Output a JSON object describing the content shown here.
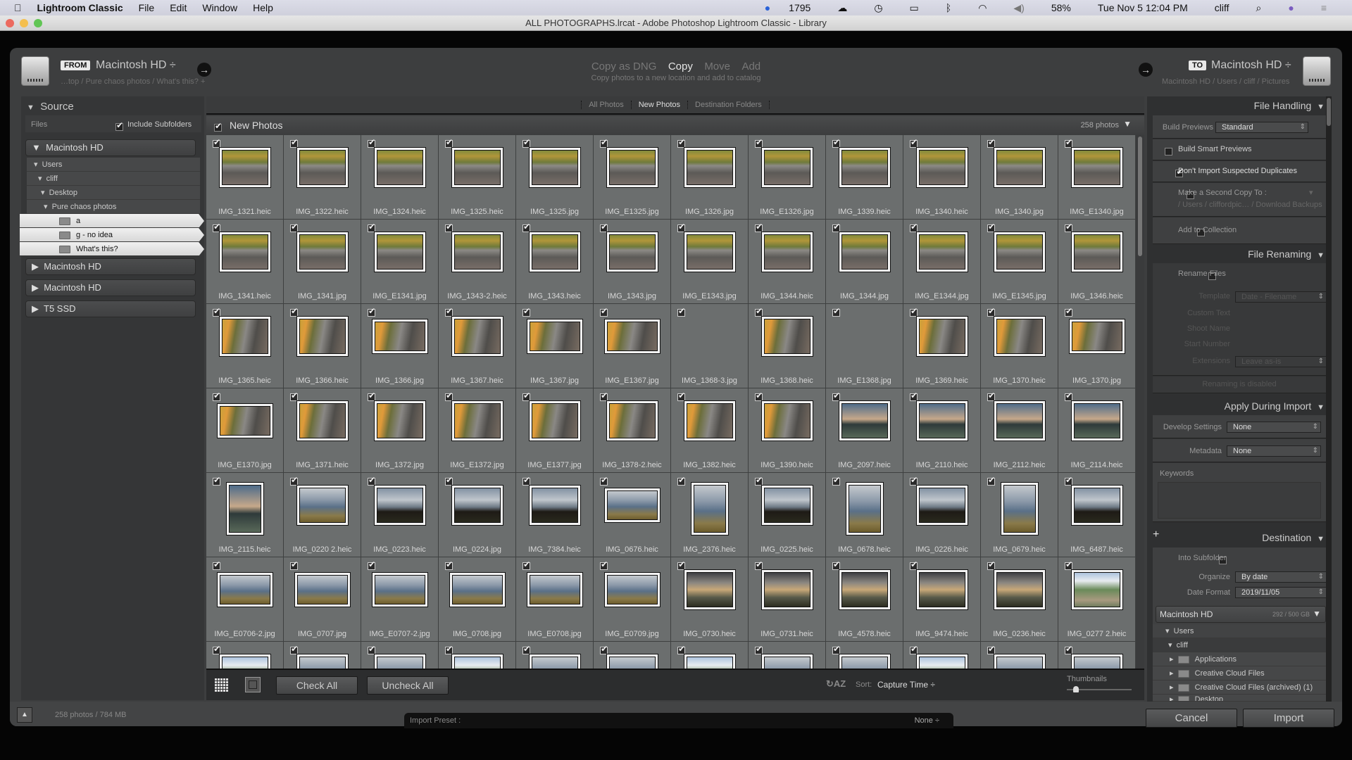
{
  "menubar": {
    "app": "Lightroom Classic",
    "items": [
      "File",
      "Edit",
      "Window",
      "Help"
    ],
    "status": {
      "badge_count": "1795",
      "battery": "58%",
      "datetime": "Tue Nov 5  12:04 PM",
      "user": "cliff"
    }
  },
  "window_title": "ALL PHOTOGRAPHS.lrcat - Adobe Photoshop Lightroom Classic - Library",
  "header": {
    "from_label": "FROM",
    "from_volume": "Macintosh HD ÷",
    "from_path": "…top / Pure chaos photos / What's this? +",
    "modes": [
      "Copy as DNG",
      "Copy",
      "Move",
      "Add"
    ],
    "active_mode": "Copy",
    "mode_description": "Copy photos to a new location and add to catalog",
    "to_label": "TO",
    "to_volume": "Macintosh HD ÷",
    "to_path": "Macintosh HD / Users / cliff / Pictures"
  },
  "source": {
    "title": "Source",
    "files_label": "Files",
    "include_subfolders": "Include Subfolders",
    "include_subfolders_checked": true,
    "tree": [
      {
        "label": "Users"
      },
      {
        "label": "cliff"
      },
      {
        "label": "Desktop"
      },
      {
        "label": "Pure chaos photos"
      }
    ],
    "folders": [
      "a",
      "g - no idea",
      "What's this?"
    ],
    "volumes": [
      "Macintosh HD",
      "Macintosh HD",
      "Macintosh HD",
      "T5 SSD"
    ]
  },
  "tabs": [
    "All Photos",
    "New Photos",
    "Destination Folders"
  ],
  "active_tab": "New Photos",
  "grid": {
    "title": "New Photos",
    "count": "258 photos",
    "photos": [
      [
        "IMG_1321.heic",
        "stream"
      ],
      [
        "IMG_1322.heic",
        "stream"
      ],
      [
        "IMG_1324.heic",
        "stream"
      ],
      [
        "IMG_1325.heic",
        "stream"
      ],
      [
        "IMG_1325.jpg",
        "stream"
      ],
      [
        "IMG_E1325.jpg",
        "stream"
      ],
      [
        "IMG_1326.jpg",
        "stream"
      ],
      [
        "IMG_E1326.jpg",
        "stream"
      ],
      [
        "IMG_1339.heic",
        "stream"
      ],
      [
        "IMG_1340.heic",
        "stream"
      ],
      [
        "IMG_1340.jpg",
        "stream"
      ],
      [
        "IMG_E1340.jpg",
        "stream"
      ],
      [
        "IMG_1341.heic",
        "stream"
      ],
      [
        "IMG_1341.jpg",
        "stream"
      ],
      [
        "IMG_E1341.jpg",
        "stream"
      ],
      [
        "IMG_1343-2.heic",
        "stream"
      ],
      [
        "IMG_1343.heic",
        "stream"
      ],
      [
        "IMG_1343.jpg",
        "stream"
      ],
      [
        "IMG_E1343.jpg",
        "stream"
      ],
      [
        "IMG_1344.heic",
        "stream"
      ],
      [
        "IMG_1344.jpg",
        "stream"
      ],
      [
        "IMG_E1344.jpg",
        "stream"
      ],
      [
        "IMG_E1345.jpg",
        "stream"
      ],
      [
        "IMG_1346.heic",
        "stream"
      ],
      [
        "IMG_1365.heic",
        "autumn"
      ],
      [
        "IMG_1366.heic",
        "autumn"
      ],
      [
        "IMG_1366.jpg",
        "autumn-wide"
      ],
      [
        "IMG_1367.heic",
        "autumn"
      ],
      [
        "IMG_1367.jpg",
        "autumn-wide"
      ],
      [
        "IMG_E1367.jpg",
        "autumn-wide"
      ],
      [
        "IMG_1368-3.jpg",
        "none"
      ],
      [
        "IMG_1368.heic",
        "autumn"
      ],
      [
        "IMG_E1368.jpg",
        "none"
      ],
      [
        "IMG_1369.heic",
        "autumn"
      ],
      [
        "IMG_1370.heic",
        "autumn"
      ],
      [
        "IMG_1370.jpg",
        "autumn-wide"
      ],
      [
        "IMG_E1370.jpg",
        "autumn-wide"
      ],
      [
        "IMG_1371.heic",
        "autumn"
      ],
      [
        "IMG_1372.jpg",
        "autumn"
      ],
      [
        "IMG_E1372.jpg",
        "autumn"
      ],
      [
        "IMG_E1377.jpg",
        "autumn"
      ],
      [
        "IMG_1378-2.heic",
        "autumn"
      ],
      [
        "IMG_1382.heic",
        "autumn"
      ],
      [
        "IMG_1390.heic",
        "autumn"
      ],
      [
        "IMG_2097.heic",
        "sunset"
      ],
      [
        "IMG_2110.heic",
        "sunset"
      ],
      [
        "IMG_2112.heic",
        "sunset"
      ],
      [
        "IMG_2114.heic",
        "sunset"
      ],
      [
        "IMG_2115.heic",
        "sunset-tall"
      ],
      [
        "IMG_0220 2.heic",
        "mountain"
      ],
      [
        "IMG_0223.heic",
        "cabin"
      ],
      [
        "IMG_0224.jpg",
        "cabin"
      ],
      [
        "IMG_7384.heic",
        "cabin"
      ],
      [
        "IMG_0676.heic",
        "mountain-wide"
      ],
      [
        "IMG_2376.heic",
        "mountain-tall"
      ],
      [
        "IMG_0225.heic",
        "cabin"
      ],
      [
        "IMG_0678.heic",
        "mountain-tall"
      ],
      [
        "IMG_0226.heic",
        "cabin"
      ],
      [
        "IMG_0679.heic",
        "mountain-tall"
      ],
      [
        "IMG_6487.heic",
        "cabin"
      ],
      [
        "IMG_E0706-2.jpg",
        "mountain-wide"
      ],
      [
        "IMG_0707.jpg",
        "mountain-wide"
      ],
      [
        "IMG_E0707-2.jpg",
        "mountain-wide"
      ],
      [
        "IMG_0708.jpg",
        "mountain-wide"
      ],
      [
        "IMG_E0708.jpg",
        "mountain-wide"
      ],
      [
        "IMG_E0709.jpg",
        "mountain-wide"
      ],
      [
        "IMG_0730.heic",
        "haze"
      ],
      [
        "IMG_0731.heic",
        "haze"
      ],
      [
        "IMG_4578.heic",
        "haze"
      ],
      [
        "IMG_9474.heic",
        "haze"
      ],
      [
        "IMG_0236.heic",
        "haze"
      ],
      [
        "IMG_0277 2.heic",
        "valley"
      ]
    ]
  },
  "toolbar": {
    "check_all": "Check All",
    "uncheck_all": "Uncheck All",
    "sort_label": "Sort:",
    "sort_value": "Capture Time ÷",
    "thumbnails_label": "Thumbnails",
    "thumbnail_size": 0.1
  },
  "footer": {
    "summary": "258 photos / 784 MB",
    "import_preset_label": "Import Preset :",
    "import_preset_value": "None ÷",
    "cancel": "Cancel",
    "import": "Import"
  },
  "file_handling": {
    "title": "File Handling",
    "build_previews_label": "Build Previews",
    "build_previews_value": "Standard",
    "build_smart_previews": "Build Smart Previews",
    "build_smart_previews_checked": false,
    "dont_import_duplicates": "Don't Import Suspected Duplicates",
    "dont_import_duplicates_checked": true,
    "second_copy": "Make a Second Copy To :",
    "second_copy_path": "/ Users / cliffordpic… / Download Backups",
    "add_to_collection": "Add to Collection"
  },
  "file_renaming": {
    "title": "File Renaming",
    "rename_files": "Rename Files",
    "template_label": "Template",
    "template_value": "Date - Filename",
    "custom_text": "Custom Text",
    "shoot_name": "Shoot Name",
    "start_number": "Start Number",
    "extensions_label": "Extensions",
    "extensions_value": "Leave as-is",
    "disabled_note": "Renaming is disabled"
  },
  "apply_during_import": {
    "title": "Apply During Import",
    "develop_label": "Develop Settings",
    "develop_value": "None",
    "metadata_label": "Metadata",
    "metadata_value": "None",
    "keywords_label": "Keywords"
  },
  "destination": {
    "title": "Destination",
    "into_subfolder": "Into Subfolder",
    "organize_label": "Organize",
    "organize_value": "By date",
    "date_format_label": "Date Format",
    "date_format_value": "2019/11/05",
    "volume": "Macintosh HD",
    "volume_usage": "292 / 500 GB",
    "tree": [
      "Users",
      "cliff"
    ],
    "folders": [
      "Applications",
      "Creative Cloud Files",
      "Creative Cloud Files (archived) (1)",
      "Desktop"
    ]
  }
}
